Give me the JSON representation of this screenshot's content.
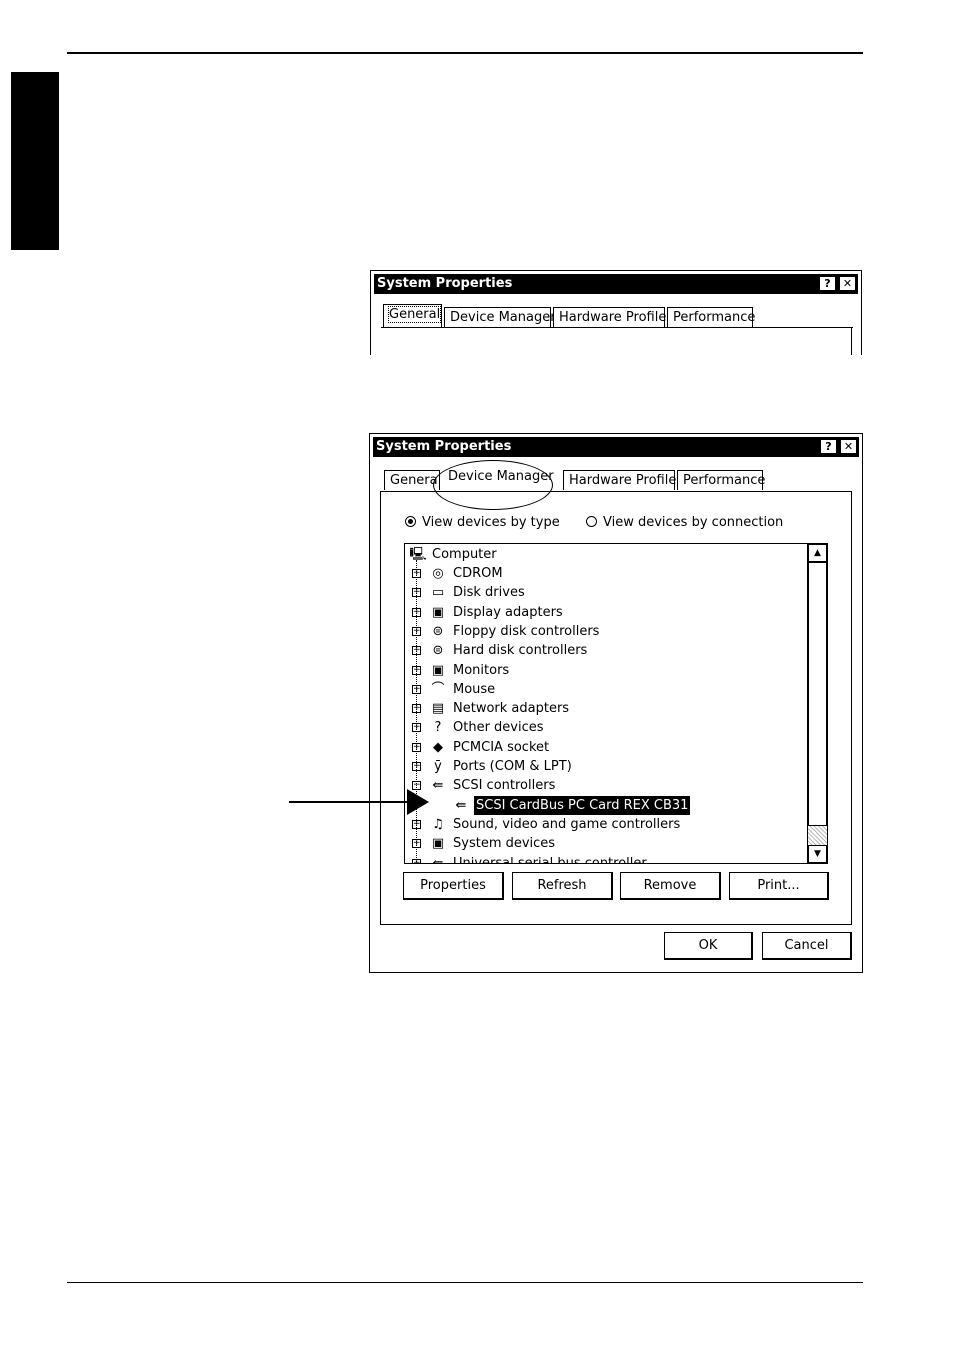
{
  "dialog1": {
    "title": "System Properties",
    "help_label": "?",
    "close_label": "✕",
    "tabs": [
      {
        "label": "General",
        "active": true
      },
      {
        "label": "Device Manager",
        "active": false
      },
      {
        "label": "Hardware Profiles",
        "active": false
      },
      {
        "label": "Performance",
        "active": false
      }
    ]
  },
  "dialog2": {
    "title": "System Properties",
    "help_label": "?",
    "close_label": "✕",
    "tabs": [
      {
        "label": "Genera"
      },
      {
        "label": "Device Manager",
        "active": true
      },
      {
        "label": "Hardware Profiles"
      },
      {
        "label": "Performance"
      }
    ],
    "view_options": [
      {
        "label": "View devices by type",
        "selected": true
      },
      {
        "label": "View devices by connection",
        "selected": false
      }
    ],
    "tree": {
      "root": {
        "label": "Computer",
        "icon": "computer-icon"
      },
      "items": [
        {
          "label": "CDROM",
          "icon": "cdrom-icon",
          "expander": "+"
        },
        {
          "label": "Disk drives",
          "icon": "disk-drive-icon",
          "expander": "+"
        },
        {
          "label": "Display adapters",
          "icon": "display-adapter-icon",
          "expander": "+"
        },
        {
          "label": "Floppy disk controllers",
          "icon": "floppy-controller-icon",
          "expander": "+"
        },
        {
          "label": "Hard disk controllers",
          "icon": "hard-disk-controller-icon",
          "expander": "+"
        },
        {
          "label": "Monitors",
          "icon": "monitor-icon",
          "expander": "+"
        },
        {
          "label": "Mouse",
          "icon": "mouse-icon",
          "expander": "+"
        },
        {
          "label": "Network adapters",
          "icon": "network-adapter-icon",
          "expander": "+"
        },
        {
          "label": "Other devices",
          "icon": "question-icon",
          "expander": "+"
        },
        {
          "label": "PCMCIA socket",
          "icon": "pcmcia-icon",
          "expander": "+"
        },
        {
          "label": "Ports (COM & LPT)",
          "icon": "port-icon",
          "expander": "+"
        },
        {
          "label": "SCSI controllers",
          "icon": "scsi-icon",
          "expander": "−"
        },
        {
          "label": "SCSI CardBus PC Card REX CB31",
          "icon": "scsi-icon",
          "child": true,
          "selected": true
        },
        {
          "label": "Sound, video and game controllers",
          "icon": "sound-icon",
          "expander": "+"
        },
        {
          "label": "System devices",
          "icon": "system-device-icon",
          "expander": "+"
        },
        {
          "label": "Universal serial bus controller",
          "icon": "usb-icon",
          "expander": "+"
        }
      ]
    },
    "buttons": {
      "properties": "Properties",
      "refresh": "Refresh",
      "remove": "Remove",
      "print": "Print...",
      "ok": "OK",
      "cancel": "Cancel"
    }
  },
  "icon_glyphs": {
    "computer-icon": "🖳",
    "cdrom-icon": "◎",
    "disk-drive-icon": "▭",
    "display-adapter-icon": "▣",
    "floppy-controller-icon": "⊜",
    "hard-disk-controller-icon": "⊜",
    "monitor-icon": "▣",
    "mouse-icon": "⌒",
    "network-adapter-icon": "▤",
    "question-icon": "?",
    "pcmcia-icon": "◆",
    "port-icon": "ȳ",
    "scsi-icon": "⇚",
    "sound-icon": "♫",
    "system-device-icon": "▣",
    "usb-icon": "⇚"
  }
}
